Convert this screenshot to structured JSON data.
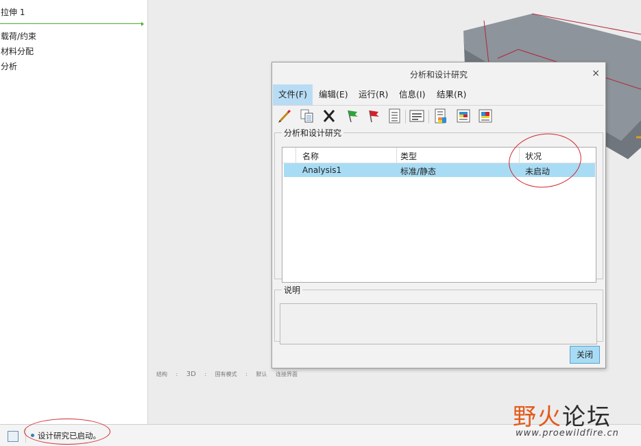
{
  "model_tree": {
    "items": [
      {
        "label": "拉伸 1"
      },
      {
        "label": "载荷/约束"
      },
      {
        "label": "材料分配"
      },
      {
        "label": "分析"
      }
    ]
  },
  "view_info": {
    "items": [
      "结构",
      ":",
      "3D",
      ":",
      "固有模式",
      ":",
      "默认",
      "连接界面"
    ]
  },
  "dialog": {
    "title": "分析和设计研究",
    "close_symbol": "×",
    "menu": [
      {
        "label": "文件(F)"
      },
      {
        "label": "编辑(E)"
      },
      {
        "label": "运行(R)"
      },
      {
        "label": "信息(I)"
      },
      {
        "label": "结果(R)"
      }
    ],
    "toolbar_icons": [
      "pencil-icon",
      "copy-icon",
      "delete-icon",
      "green-flag-icon",
      "red-flag-icon",
      "checklist-icon",
      "status-icon",
      "review-results-icon",
      "results-icon",
      "results-window-icon"
    ],
    "group_label": "分析和设计研究",
    "columns": [
      "名称",
      "类型",
      "状况"
    ],
    "rows": [
      {
        "name": "Analysis1",
        "type": "标准/静态",
        "status": "未启动"
      }
    ],
    "description_label": "说明",
    "description_value": "",
    "close_button": "关闭",
    "selection_color": "#a8dcf4"
  },
  "status_bar": {
    "message": "设计研究已启动。"
  },
  "watermark": {
    "logo_part1": "野火",
    "logo_part2": "论坛",
    "url": "www.proewildfire.cn"
  },
  "colors": {
    "annotation_red": "#d4262c",
    "accent_blue": "#a8dcf4",
    "insert_green": "#4caf2e"
  }
}
